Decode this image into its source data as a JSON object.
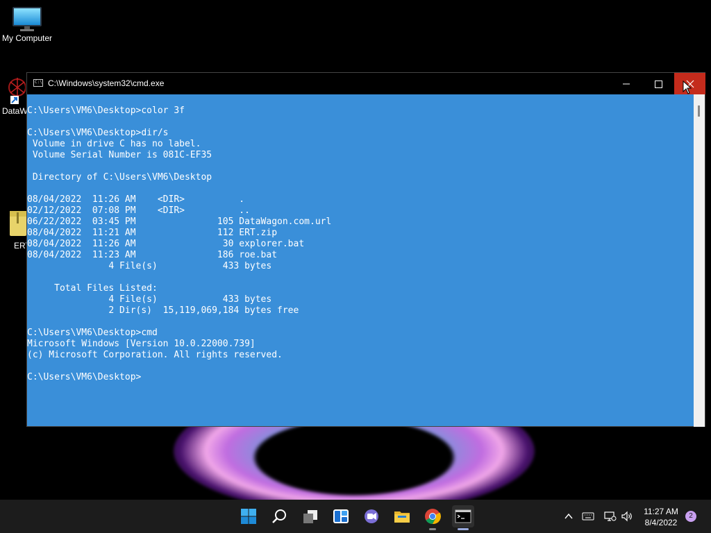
{
  "desktop": {
    "icons": [
      {
        "label": "My Computer",
        "icon": "monitor-icon"
      },
      {
        "label": "DataW",
        "icon": "datawagon-shortcut-icon"
      },
      {
        "label": "ERT",
        "icon": "zip-folder-icon"
      }
    ]
  },
  "window": {
    "title": "C:\\Windows\\system32\\cmd.exe",
    "minimize": "—",
    "close": "✕",
    "icon": "cmd-icon",
    "background": "#3a8fd9"
  },
  "terminal": {
    "lines": [
      "C:\\Users\\VM6\\Desktop>color 3f",
      "",
      "C:\\Users\\VM6\\Desktop>dir/s",
      " Volume in drive C has no label.",
      " Volume Serial Number is 081C-EF35",
      "",
      " Directory of C:\\Users\\VM6\\Desktop",
      "",
      "08/04/2022  11:26 AM    <DIR>          .",
      "02/12/2022  07:08 PM    <DIR>          ..",
      "06/22/2022  03:45 PM               105 DataWagon.com.url",
      "08/04/2022  11:21 AM               112 ERT.zip",
      "08/04/2022  11:26 AM                30 explorer.bat",
      "08/04/2022  11:23 AM               186 roe.bat",
      "               4 File(s)            433 bytes",
      "",
      "     Total Files Listed:",
      "               4 File(s)            433 bytes",
      "               2 Dir(s)  15,119,069,184 bytes free",
      "",
      "C:\\Users\\VM6\\Desktop>cmd",
      "Microsoft Windows [Version 10.0.22000.739]",
      "(c) Microsoft Corporation. All rights reserved.",
      "",
      "C:\\Users\\VM6\\Desktop>"
    ]
  },
  "taskbar": {
    "apps": [
      {
        "name": "start",
        "icon": "windows-logo-icon"
      },
      {
        "name": "search",
        "icon": "search-icon"
      },
      {
        "name": "task-view",
        "icon": "task-view-icon"
      },
      {
        "name": "widgets",
        "icon": "widgets-icon"
      },
      {
        "name": "chat",
        "icon": "teams-chat-icon"
      },
      {
        "name": "file-explorer",
        "icon": "folder-icon"
      },
      {
        "name": "chrome",
        "icon": "chrome-icon"
      },
      {
        "name": "terminal",
        "icon": "cmd-icon"
      }
    ],
    "clock": {
      "time": "11:27 AM",
      "date": "8/4/2022"
    },
    "notifications": "2"
  }
}
